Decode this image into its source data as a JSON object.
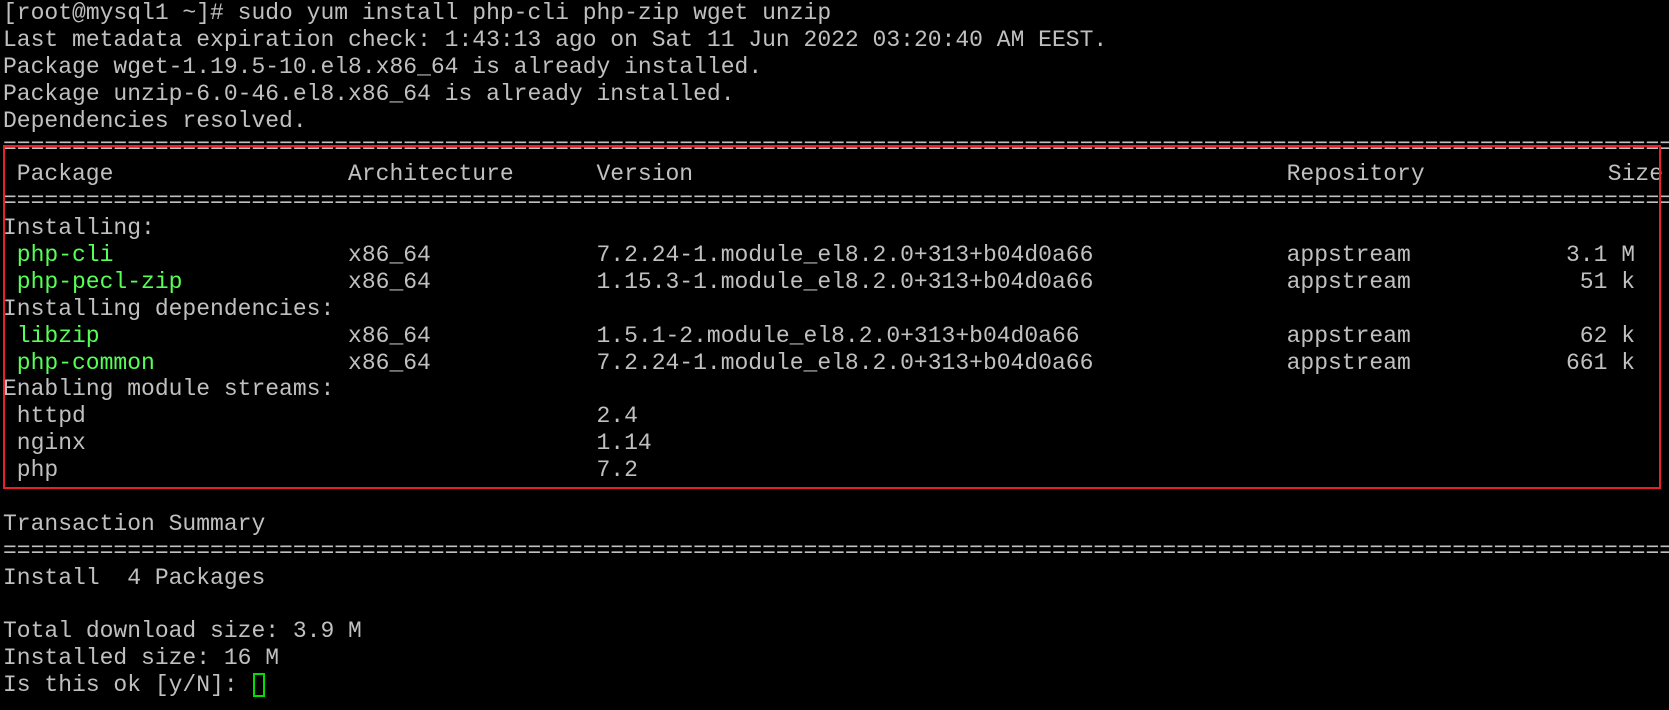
{
  "colors": {
    "text": "#c0c0c0",
    "package": "#55ff55",
    "highlight_box": "#e8202a",
    "cursor": "#00e000",
    "background": "#000000"
  },
  "pre_lines": [
    "[root@mysql1 ~]# sudo yum install php-cli php-zip wget unzip",
    "Last metadata expiration check: 1:43:13 ago on Sat 11 Jun 2022 03:20:40 AM EEST.",
    "Package wget-1.19.5-10.el8.x86_64 is already installed.",
    "Package unzip-6.0-46.el8.x86_64 is already installed.",
    "Dependencies resolved."
  ],
  "rule": "=========================================================================================================================",
  "table": {
    "headers": {
      "package": "Package",
      "arch": "Architecture",
      "version": "Version",
      "repo": "Repository",
      "size": "Size"
    },
    "groups": [
      {
        "label": "Installing:",
        "rows": [
          {
            "package": "php-cli",
            "arch": "x86_64",
            "version": "7.2.24-1.module_el8.2.0+313+b04d0a66",
            "repo": "appstream",
            "size": "3.1 M"
          },
          {
            "package": "php-pecl-zip",
            "arch": "x86_64",
            "version": "1.15.3-1.module_el8.2.0+313+b04d0a66",
            "repo": "appstream",
            "size": "51 k"
          }
        ]
      },
      {
        "label": "Installing dependencies:",
        "rows": [
          {
            "package": "libzip",
            "arch": "x86_64",
            "version": "1.5.1-2.module_el8.2.0+313+b04d0a66",
            "repo": "appstream",
            "size": "62 k"
          },
          {
            "package": "php-common",
            "arch": "x86_64",
            "version": "7.2.24-1.module_el8.2.0+313+b04d0a66",
            "repo": "appstream",
            "size": "661 k"
          }
        ]
      }
    ],
    "streams_label": "Enabling module streams:",
    "streams": [
      {
        "name": "httpd",
        "version": "2.4"
      },
      {
        "name": "nginx",
        "version": "1.14"
      },
      {
        "name": "php",
        "version": "7.2"
      }
    ]
  },
  "summary": {
    "title": "Transaction Summary",
    "install": "Install  4 Packages",
    "total_download": "Total download size: 3.9 M",
    "installed_size": "Installed size: 16 M",
    "prompt": "Is this ok [y/N]: "
  }
}
